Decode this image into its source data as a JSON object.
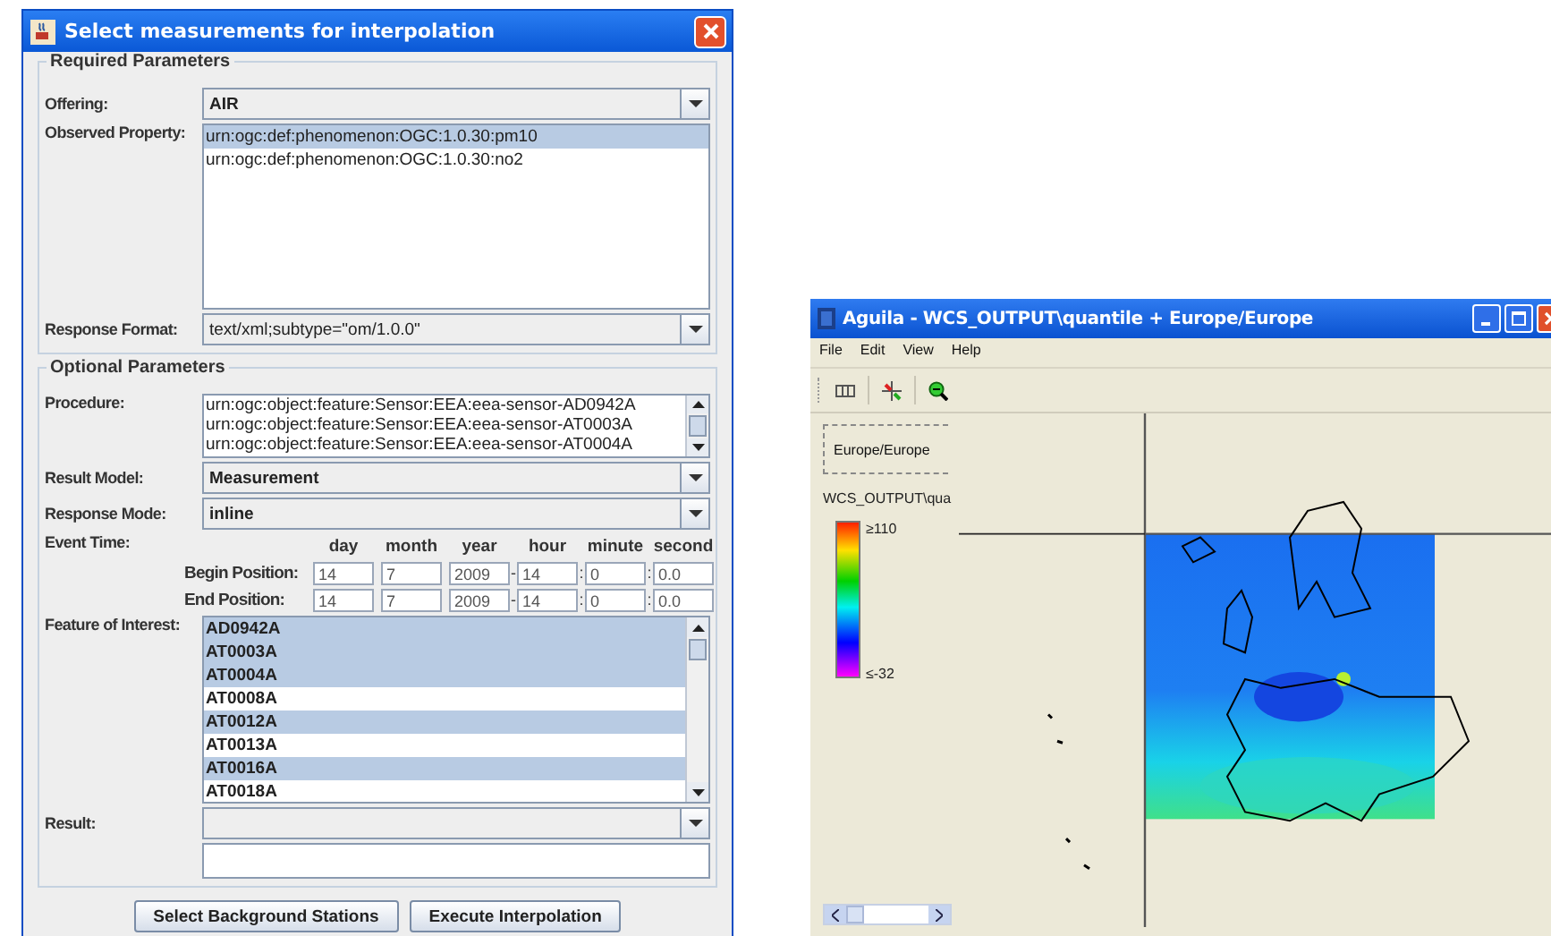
{
  "dialog": {
    "title": "Select measurements for interpolation",
    "required": {
      "legend": "Required Parameters",
      "offering": {
        "label": "Offering:",
        "value": "AIR"
      },
      "observed_property": {
        "label": "Observed Property:",
        "items": [
          {
            "text": "urn:ogc:def:phenomenon:OGC:1.0.30:pm10",
            "selected": true
          },
          {
            "text": "urn:ogc:def:phenomenon:OGC:1.0.30:no2",
            "selected": false
          }
        ]
      },
      "response_format": {
        "label": "Response Format:",
        "value": "text/xml;subtype=\"om/1.0.0\""
      }
    },
    "optional": {
      "legend": "Optional Parameters",
      "procedure": {
        "label": "Procedure:",
        "items": [
          "urn:ogc:object:feature:Sensor:EEA:eea-sensor-AD0942A",
          "urn:ogc:object:feature:Sensor:EEA:eea-sensor-AT0003A",
          "urn:ogc:object:feature:Sensor:EEA:eea-sensor-AT0004A"
        ]
      },
      "result_model": {
        "label": "Result Model:",
        "value": "Measurement"
      },
      "response_mode": {
        "label": "Response Mode:",
        "value": "inline"
      },
      "event_time": {
        "label": "Event Time:",
        "columns": [
          "day",
          "month",
          "year",
          "hour",
          "minute",
          "second"
        ],
        "rows": [
          {
            "label": "Begin Position:",
            "fields": [
              {
                "value": "14"
              },
              {
                "value": "7"
              },
              {
                "value": "2009"
              },
              {
                "sep": "-",
                "value": "14"
              },
              {
                "sep": ":",
                "value": "0"
              },
              {
                "sep": ":",
                "value": "0.0"
              }
            ]
          },
          {
            "label": "End Position:",
            "fields": [
              {
                "value": "14"
              },
              {
                "value": "7"
              },
              {
                "value": "2009"
              },
              {
                "sep": "-",
                "value": "14"
              },
              {
                "sep": ":",
                "value": "0"
              },
              {
                "sep": ":",
                "value": "0.0"
              }
            ]
          }
        ]
      },
      "feature_of_interest": {
        "label": "Feature of Interest:",
        "items": [
          {
            "text": "AD0942A",
            "selected": true
          },
          {
            "text": "AT0003A",
            "selected": true
          },
          {
            "text": "AT0004A",
            "selected": true
          },
          {
            "text": "AT0008A",
            "selected": false
          },
          {
            "text": "AT0012A",
            "selected": true
          },
          {
            "text": "AT0013A",
            "selected": false
          },
          {
            "text": "AT0016A",
            "selected": true
          },
          {
            "text": "AT0018A",
            "selected": false
          }
        ]
      },
      "result": {
        "label": "Result:"
      }
    },
    "buttons": [
      "Select Background Stations",
      "Execute Interpolation"
    ]
  },
  "aguila": {
    "title": "Aguila - WCS_OUTPUT\\quantile + Europe/Europe",
    "menu": [
      "File",
      "Edit",
      "View",
      "Help"
    ],
    "legend": {
      "view_label": "Europe/Europe",
      "layer_label": "WCS_OUTPUT\\qua",
      "max_label": "≥110",
      "min_label": "≤-32"
    }
  }
}
